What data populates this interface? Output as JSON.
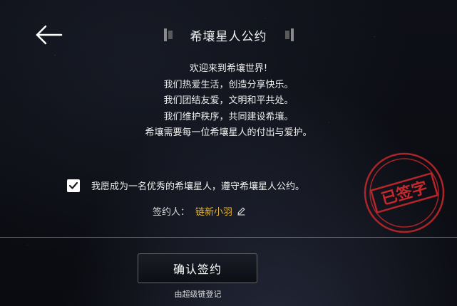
{
  "header": {
    "title": "希壤星人公约",
    "back_icon": "arrow-left-icon"
  },
  "pledge": {
    "lines": [
      "欢迎来到希壤世界!",
      "我们热爱生活，创造分享快乐。",
      "我们团结友爱，文明和平共处。",
      "我们维护秩序，共同建设希壤。",
      "希壤需要每一位希壤星人的付出与爱护。"
    ]
  },
  "agreement": {
    "checked": true,
    "text": "我愿成为一名优秀的希壤星人，遵守希壤星人公约。"
  },
  "signer": {
    "label": "签约人：",
    "name": "链新小羽",
    "edit_icon": "pencil-icon",
    "name_color": "#e2b539"
  },
  "stamp": {
    "text": "已签字",
    "color": "#c8282c"
  },
  "actions": {
    "confirm_label": "确认签约"
  },
  "footer": {
    "text": "由超级链登记"
  }
}
